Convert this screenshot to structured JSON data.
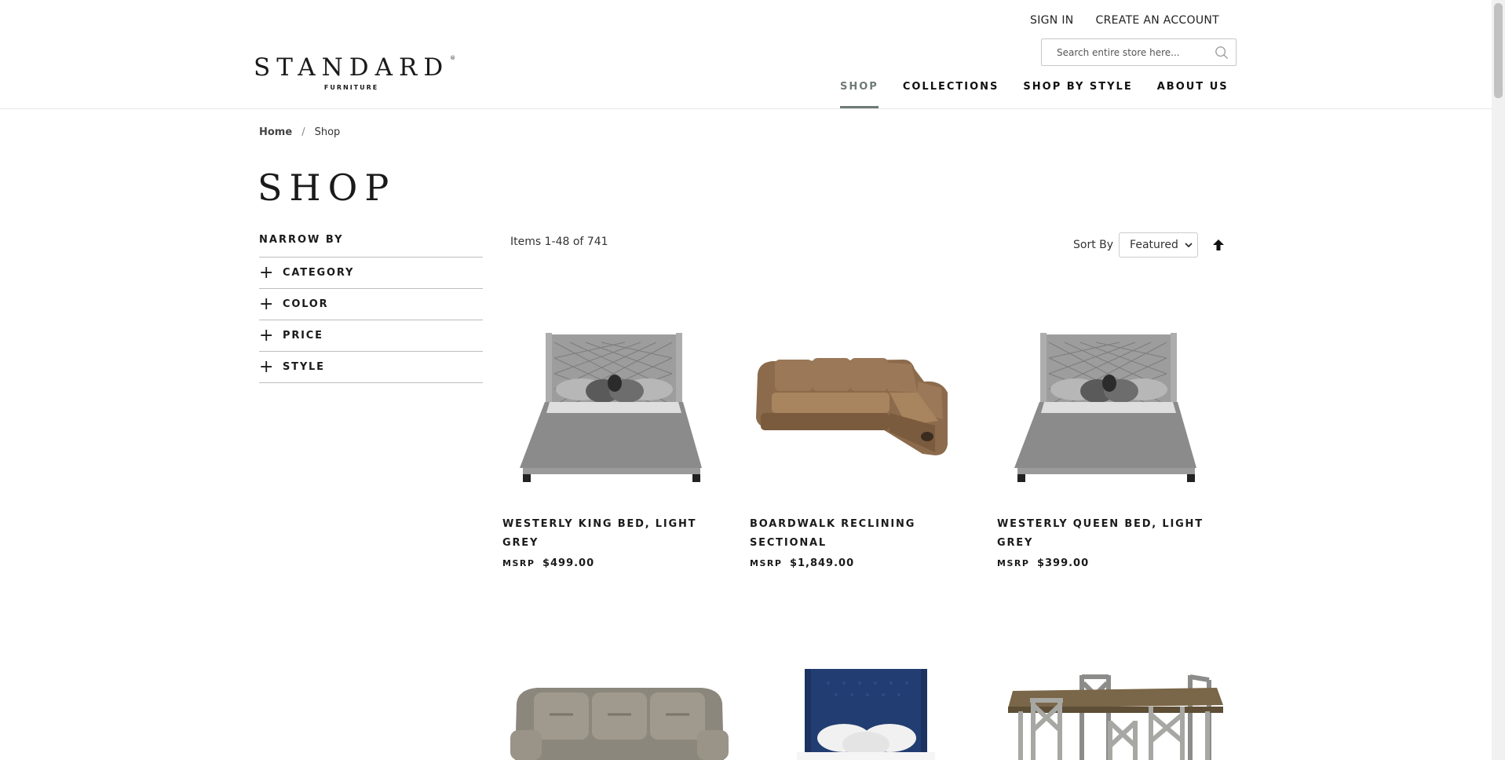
{
  "header": {
    "sign_in": "SIGN IN",
    "create_account": "CREATE AN ACCOUNT",
    "search_placeholder": "Search entire store here...",
    "logo_word": "STANDARD",
    "logo_reg": "®",
    "logo_sub": "FURNITURE",
    "nav": [
      "SHOP",
      "COLLECTIONS",
      "SHOP BY STYLE",
      "ABOUT US"
    ],
    "active_nav": "SHOP",
    "accent_color": "#6f7b75"
  },
  "breadcrumb": {
    "home": "Home",
    "separator": "/",
    "current": "Shop"
  },
  "page_title": "SHOP",
  "sidebar": {
    "title": "NARROW BY",
    "filters": [
      "CATEGORY",
      "COLOR",
      "PRICE",
      "STYLE"
    ]
  },
  "toolbar": {
    "count": "Items 1-48 of 741",
    "sort_label": "Sort By",
    "sort_value": "Featured"
  },
  "products": [
    {
      "name": "WESTERLY KING BED, LIGHT GREY",
      "msrp": "MSRP",
      "price": "$499.00",
      "image": "grey-upholstered-bed"
    },
    {
      "name": "BOARDWALK RECLINING SECTIONAL",
      "msrp": "MSRP",
      "price": "$1,849.00",
      "image": "brown-reclining-sectional"
    },
    {
      "name": "WESTERLY QUEEN BED, LIGHT GREY",
      "msrp": "MSRP",
      "price": "$399.00",
      "image": "grey-upholstered-bed"
    },
    {
      "image": "grey-leather-sofa"
    },
    {
      "image": "navy-upholstered-bed"
    },
    {
      "image": "dining-table-set"
    }
  ]
}
